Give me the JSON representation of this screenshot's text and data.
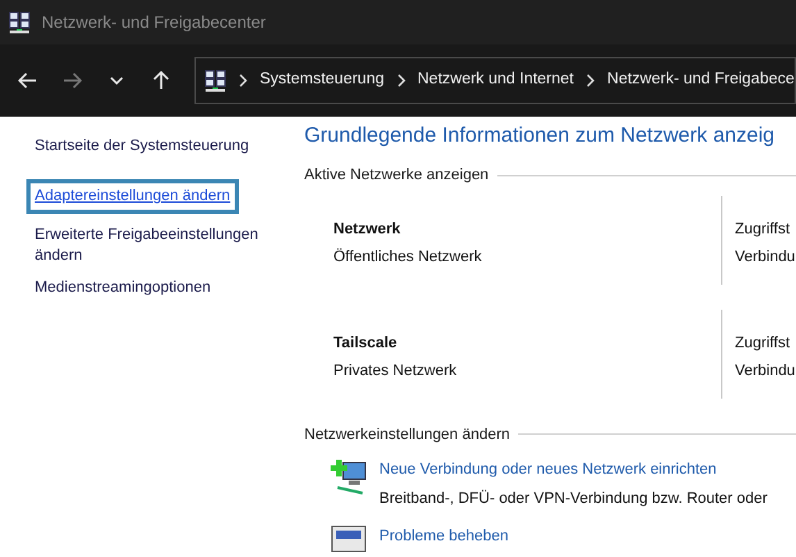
{
  "window": {
    "title": "Netzwerk- und Freigabecenter"
  },
  "nav": [
    {
      "kind": "back",
      "disabled": false
    },
    {
      "kind": "forward",
      "disabled": true
    },
    {
      "kind": "recent",
      "disabled": false
    },
    {
      "kind": "up",
      "disabled": false
    }
  ],
  "breadcrumbs": [
    "Systemsteuerung",
    "Netzwerk und Internet",
    "Netzwerk- und Freigabece"
  ],
  "sidebar": {
    "items": [
      {
        "label": "Startseite der Systemsteuerung",
        "selected": false
      },
      {
        "label": "Adaptereinstellungen ändern",
        "selected": true
      },
      {
        "label": "Erweiterte Freigabeeinstellungen ändern",
        "selected": false
      },
      {
        "label": "Medienstreamingoptionen",
        "selected": false
      }
    ]
  },
  "main": {
    "heading": "Grundlegende Informationen zum Netzwerk anzeig",
    "active_section": "Aktive Netzwerke anzeigen",
    "networks": [
      {
        "name": "Netzwerk",
        "type": "Öffentliches Netzwerk",
        "column_2": [
          "Zugriffst",
          "Verbindu"
        ]
      },
      {
        "name": "Tailscale",
        "type": "Privates Netzwerk",
        "column_2": [
          "Zugriffst",
          "Verbindu"
        ]
      }
    ],
    "settings_section": "Netzwerkeinstellungen ändern",
    "tasks": [
      {
        "kind": "new-connection",
        "link": "Neue Verbindung oder neues Netzwerk einrichten",
        "description": "Breitband-, DFÜ- oder VPN-Verbindung bzw. Router oder"
      },
      {
        "kind": "troubleshoot",
        "link": "Probleme beheben"
      }
    ]
  }
}
